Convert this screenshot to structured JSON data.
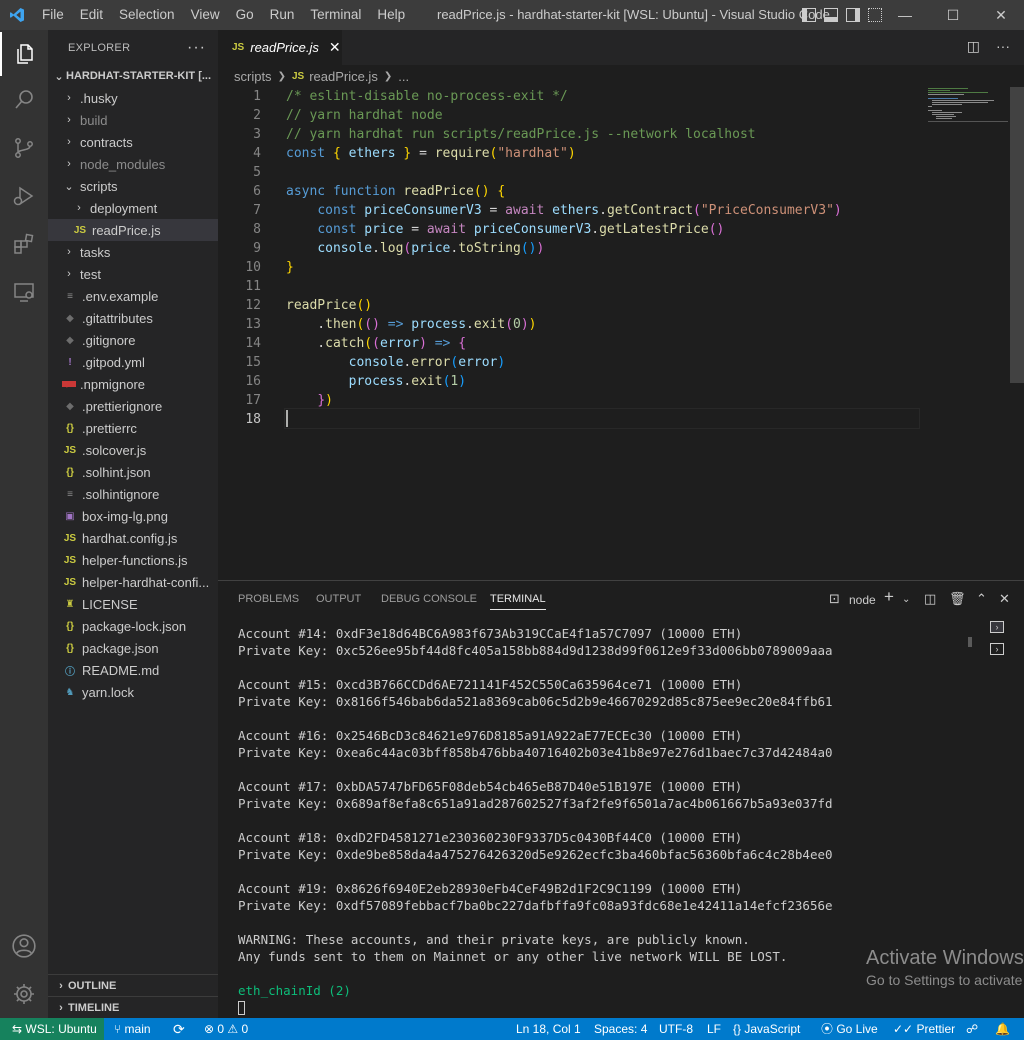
{
  "titlebar": {
    "menu": [
      "File",
      "Edit",
      "Selection",
      "View",
      "Go",
      "Run",
      "Terminal",
      "Help"
    ],
    "window_title": "readPrice.js - hardhat-starter-kit [WSL: Ubuntu] - Visual Studio Code",
    "minimize": "—",
    "maximize": "☐",
    "close": "✕"
  },
  "activity_bar": [
    "files-icon",
    "search-icon",
    "source-control-icon",
    "run-debug-icon",
    "extensions-icon",
    "remote-explorer-icon",
    "account-icon",
    "gear-icon"
  ],
  "sidebar": {
    "title": "EXPLORER",
    "more": "···",
    "root": "HARDHAT-STARTER-KIT [...",
    "items": [
      {
        "label": ".husky",
        "type": "folder"
      },
      {
        "label": "build",
        "type": "folder",
        "dim": true
      },
      {
        "label": "contracts",
        "type": "folder"
      },
      {
        "label": "node_modules",
        "type": "folder",
        "dim": true
      },
      {
        "label": "scripts",
        "type": "folder-open"
      },
      {
        "label": "deployment",
        "type": "folder"
      },
      {
        "label": "readPrice.js",
        "type": "js"
      },
      {
        "label": "tasks",
        "type": "folder"
      },
      {
        "label": "test",
        "type": "folder"
      },
      {
        "label": ".env.example",
        "type": "lines"
      },
      {
        "label": ".gitattributes",
        "type": "diamond"
      },
      {
        "label": ".gitignore",
        "type": "diamond"
      },
      {
        "label": ".gitpod.yml",
        "type": "bang"
      },
      {
        "label": ".npmignore",
        "type": "npm"
      },
      {
        "label": ".prettierignore",
        "type": "diamond"
      },
      {
        "label": ".prettierrc",
        "type": "braces"
      },
      {
        "label": ".solcover.js",
        "type": "js"
      },
      {
        "label": ".solhint.json",
        "type": "braces"
      },
      {
        "label": ".solhintignore",
        "type": "lines"
      },
      {
        "label": "box-img-lg.png",
        "type": "image"
      },
      {
        "label": "hardhat.config.js",
        "type": "js"
      },
      {
        "label": "helper-functions.js",
        "type": "js"
      },
      {
        "label": "helper-hardhat-confi...",
        "type": "js"
      },
      {
        "label": "LICENSE",
        "type": "license"
      },
      {
        "label": "package-lock.json",
        "type": "braces"
      },
      {
        "label": "package.json",
        "type": "braces"
      },
      {
        "label": "README.md",
        "type": "info"
      },
      {
        "label": "yarn.lock",
        "type": "yarn"
      }
    ],
    "outline": "OUTLINE",
    "timeline": "TIMELINE"
  },
  "tabs": [
    {
      "label": "readPrice.js",
      "icon": "JS",
      "close": "✕"
    }
  ],
  "breadcrumb": {
    "folder": "scripts",
    "file": "readPrice.js",
    "tail": "..."
  },
  "editor": {
    "lines": [
      {
        "n": "1",
        "t": [
          [
            "c-cm",
            "/* eslint-disable no-process-exit */"
          ]
        ]
      },
      {
        "n": "2",
        "t": [
          [
            "c-cm",
            "// yarn hardhat node"
          ]
        ]
      },
      {
        "n": "3",
        "t": [
          [
            "c-cm",
            "// yarn hardhat run scripts/readPrice.js --network localhost"
          ]
        ]
      },
      {
        "n": "4",
        "t": [
          [
            "c-kw",
            "const"
          ],
          [
            "c-p",
            " "
          ],
          [
            "c-b1",
            "{"
          ],
          [
            "c-p",
            " "
          ],
          [
            "c-var",
            "ethers"
          ],
          [
            "c-p",
            " "
          ],
          [
            "c-b1",
            "}"
          ],
          [
            "c-p",
            " = "
          ],
          [
            "c-fn",
            "require"
          ],
          [
            "c-b1",
            "("
          ],
          [
            "c-str",
            "\"hardhat\""
          ],
          [
            "c-b1",
            ")"
          ]
        ]
      },
      {
        "n": "5",
        "t": []
      },
      {
        "n": "6",
        "t": [
          [
            "c-kw",
            "async"
          ],
          [
            "c-p",
            " "
          ],
          [
            "c-kw",
            "function"
          ],
          [
            "c-p",
            " "
          ],
          [
            "c-fn",
            "readPrice"
          ],
          [
            "c-b1",
            "()"
          ],
          [
            "c-p",
            " "
          ],
          [
            "c-b1",
            "{"
          ]
        ]
      },
      {
        "n": "7",
        "t": [
          [
            "c-p",
            "    "
          ],
          [
            "c-kw",
            "const"
          ],
          [
            "c-p",
            " "
          ],
          [
            "c-var",
            "priceConsumerV3"
          ],
          [
            "c-p",
            " = "
          ],
          [
            "c-ctl",
            "await"
          ],
          [
            "c-p",
            " "
          ],
          [
            "c-var",
            "ethers"
          ],
          [
            "c-p",
            "."
          ],
          [
            "c-fn",
            "getContract"
          ],
          [
            "c-b2",
            "("
          ],
          [
            "c-str",
            "\"PriceConsumerV3\""
          ],
          [
            "c-b2",
            ")"
          ]
        ]
      },
      {
        "n": "8",
        "t": [
          [
            "c-p",
            "    "
          ],
          [
            "c-kw",
            "const"
          ],
          [
            "c-p",
            " "
          ],
          [
            "c-var",
            "price"
          ],
          [
            "c-p",
            " = "
          ],
          [
            "c-ctl",
            "await"
          ],
          [
            "c-p",
            " "
          ],
          [
            "c-var",
            "priceConsumerV3"
          ],
          [
            "c-p",
            "."
          ],
          [
            "c-fn",
            "getLatestPrice"
          ],
          [
            "c-b2",
            "()"
          ]
        ]
      },
      {
        "n": "9",
        "t": [
          [
            "c-p",
            "    "
          ],
          [
            "c-var",
            "console"
          ],
          [
            "c-p",
            "."
          ],
          [
            "c-fn",
            "log"
          ],
          [
            "c-b2",
            "("
          ],
          [
            "c-var",
            "price"
          ],
          [
            "c-p",
            "."
          ],
          [
            "c-fn",
            "toString"
          ],
          [
            "c-b3",
            "()"
          ],
          [
            "c-b2",
            ")"
          ]
        ]
      },
      {
        "n": "10",
        "t": [
          [
            "c-b1",
            "}"
          ]
        ]
      },
      {
        "n": "11",
        "t": []
      },
      {
        "n": "12",
        "t": [
          [
            "c-fn",
            "readPrice"
          ],
          [
            "c-b1",
            "()"
          ]
        ]
      },
      {
        "n": "13",
        "t": [
          [
            "c-p",
            "    ."
          ],
          [
            "c-fn",
            "then"
          ],
          [
            "c-b1",
            "("
          ],
          [
            "c-b2",
            "()"
          ],
          [
            "c-p",
            " "
          ],
          [
            "c-kw",
            "=>"
          ],
          [
            "c-p",
            " "
          ],
          [
            "c-var",
            "process"
          ],
          [
            "c-p",
            "."
          ],
          [
            "c-fn",
            "exit"
          ],
          [
            "c-b2",
            "("
          ],
          [
            "c-num",
            "0"
          ],
          [
            "c-b2",
            ")"
          ],
          [
            "c-b1",
            ")"
          ]
        ]
      },
      {
        "n": "14",
        "t": [
          [
            "c-p",
            "    ."
          ],
          [
            "c-fn",
            "catch"
          ],
          [
            "c-b1",
            "("
          ],
          [
            "c-b2",
            "("
          ],
          [
            "c-var",
            "error"
          ],
          [
            "c-b2",
            ")"
          ],
          [
            "c-p",
            " "
          ],
          [
            "c-kw",
            "=>"
          ],
          [
            "c-p",
            " "
          ],
          [
            "c-b2",
            "{"
          ]
        ]
      },
      {
        "n": "15",
        "t": [
          [
            "c-p",
            "        "
          ],
          [
            "c-var",
            "console"
          ],
          [
            "c-p",
            "."
          ],
          [
            "c-fn",
            "error"
          ],
          [
            "c-b3",
            "("
          ],
          [
            "c-var",
            "error"
          ],
          [
            "c-b3",
            ")"
          ]
        ]
      },
      {
        "n": "16",
        "t": [
          [
            "c-p",
            "        "
          ],
          [
            "c-var",
            "process"
          ],
          [
            "c-p",
            "."
          ],
          [
            "c-fn",
            "exit"
          ],
          [
            "c-b3",
            "("
          ],
          [
            "c-num",
            "1"
          ],
          [
            "c-b3",
            ")"
          ]
        ]
      },
      {
        "n": "17",
        "t": [
          [
            "c-p",
            "    "
          ],
          [
            "c-b2",
            "}"
          ],
          [
            "c-b1",
            ")"
          ]
        ]
      },
      {
        "n": "18",
        "t": []
      }
    ]
  },
  "panel": {
    "tabs": [
      "PROBLEMS",
      "OUTPUT",
      "DEBUG CONSOLE",
      "TERMINAL"
    ],
    "terminal_name": "node",
    "terminal_lines": [
      "Account #14: 0xdF3e18d64BC6A983f673Ab319CCaE4f1a57C7097 (10000 ETH)",
      "Private Key: 0xc526ee95bf44d8fc405a158bb884d9d1238d99f0612e9f33d006bb0789009aaa",
      "",
      "Account #15: 0xcd3B766CCDd6AE721141F452C550Ca635964ce71 (10000 ETH)",
      "Private Key: 0x8166f546bab6da521a8369cab06c5d2b9e46670292d85c875ee9ec20e84ffb61",
      "",
      "Account #16: 0x2546BcD3c84621e976D8185a91A922aE77ECEc30 (10000 ETH)",
      "Private Key: 0xea6c44ac03bff858b476bba40716402b03e41b8e97e276d1baec7c37d42484a0",
      "",
      "Account #17: 0xbDA5747bFD65F08deb54cb465eB87D40e51B197E (10000 ETH)",
      "Private Key: 0x689af8efa8c651a91ad287602527f3af2fe9f6501a7ac4b061667b5a93e037fd",
      "",
      "Account #18: 0xdD2FD4581271e230360230F9337D5c0430Bf44C0 (10000 ETH)",
      "Private Key: 0xde9be858da4a475276426320d5e9262ecfc3ba460bfac56360bfa6c4c28b4ee0",
      "",
      "Account #19: 0x8626f6940E2eb28930eFb4CeF49B2d1F2C9C1199 (10000 ETH)",
      "Private Key: 0xdf57089febbacf7ba0bc227dafbffa9fc08a93fdc68e1e42411a14efcf23656e",
      "",
      "WARNING: These accounts, and their private keys, are publicly known.",
      "Any funds sent to them on Mainnet or any other live network WILL BE LOST.",
      "",
      "eth_chainId (2)"
    ],
    "watermark_title": "Activate Windows",
    "watermark_sub": "Go to Settings to activate"
  },
  "statusbar": {
    "remote": "WSL: Ubuntu",
    "branch": "main",
    "errors": "0",
    "warnings": "0",
    "position": "Ln 18, Col 1",
    "spaces": "Spaces: 4",
    "encoding": "UTF-8",
    "eol": "LF",
    "language": "JavaScript",
    "golive": "Go Live",
    "prettier": "Prettier"
  }
}
